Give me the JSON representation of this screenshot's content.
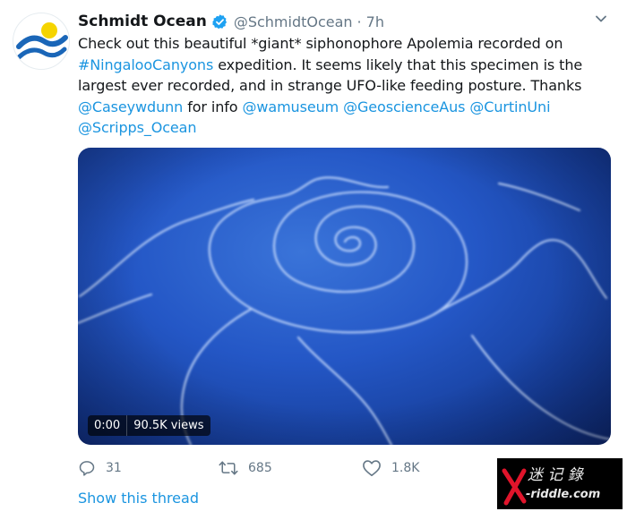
{
  "tweet": {
    "display_name": "Schmidt Ocean",
    "handle": "@SchmidtOcean",
    "separator": "·",
    "time": "7h",
    "text_parts": [
      {
        "t": "Check out this beautiful *giant* siphonophore Apolemia recorded on ",
        "link": false
      },
      {
        "t": "#NingalooCanyons",
        "link": true
      },
      {
        "t": " expedition. It seems likely that this specimen is the largest ever recorded, and in strange UFO-like feeding posture. Thanks ",
        "link": false
      },
      {
        "t": "@Caseywdunn",
        "link": true
      },
      {
        "t": " for info ",
        "link": false
      },
      {
        "t": "@wamuseum",
        "link": true
      },
      {
        "t": " ",
        "link": false
      },
      {
        "t": "@GeoscienceAus",
        "link": true
      },
      {
        "t": " ",
        "link": false
      },
      {
        "t": "@CurtinUni",
        "link": true
      },
      {
        "t": " ",
        "link": false
      },
      {
        "t": "@Scripps_Ocean",
        "link": true
      }
    ]
  },
  "video": {
    "time": "0:00",
    "views": "90.5K views"
  },
  "actions": {
    "reply_count": "31",
    "retweet_count": "685",
    "like_count": "1.8K"
  },
  "show_thread": "Show this thread",
  "watermark": {
    "cjk": "迷 记 錄",
    "latin": "X-riddle.com"
  },
  "colors": {
    "link": "#1b95e0",
    "secondary": "#657786",
    "verified": "#1da1f2",
    "video_blue": "#2457c6"
  },
  "icons": [
    "verified-badge-icon",
    "chevron-down-icon",
    "reply-icon",
    "retweet-icon",
    "like-icon"
  ]
}
